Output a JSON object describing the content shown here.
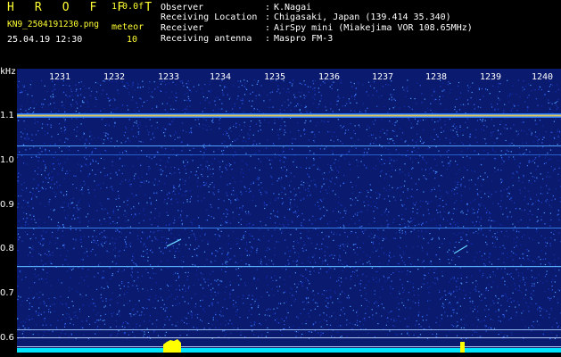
{
  "header": {
    "title": "H R O F F T",
    "version": "1.0.0f",
    "filename": "KN9_2504191230.png",
    "meteor_label": "meteor",
    "datetime": "25.04.19 12:30",
    "meteor_count": "10",
    "info": [
      {
        "label": "Observer",
        "value": "K.Nagai"
      },
      {
        "label": "Receiving Location",
        "value": "Chigasaki, Japan (139.414 35.340)"
      },
      {
        "label": "Receiver",
        "value": "AirSpy mini (Miakejima VOR 108.65MHz)"
      },
      {
        "label": "Receiving antenna",
        "value": "Maspro FM-3"
      }
    ],
    "separator": ":"
  },
  "plot": {
    "unit": "kHz",
    "time_ticks": [
      "1231",
      "1232",
      "1233",
      "1234",
      "1235",
      "1236",
      "1237",
      "1238",
      "1239",
      "1240"
    ],
    "freq_ticks": [
      "1.1",
      "1.0",
      "0.9",
      "0.8",
      "0.7",
      "0.6"
    ],
    "colors": {
      "background": "#0a1a6e",
      "carrier": "#ffd23c",
      "baseline": "#00e5ff",
      "burst": "#ffff00"
    }
  }
}
